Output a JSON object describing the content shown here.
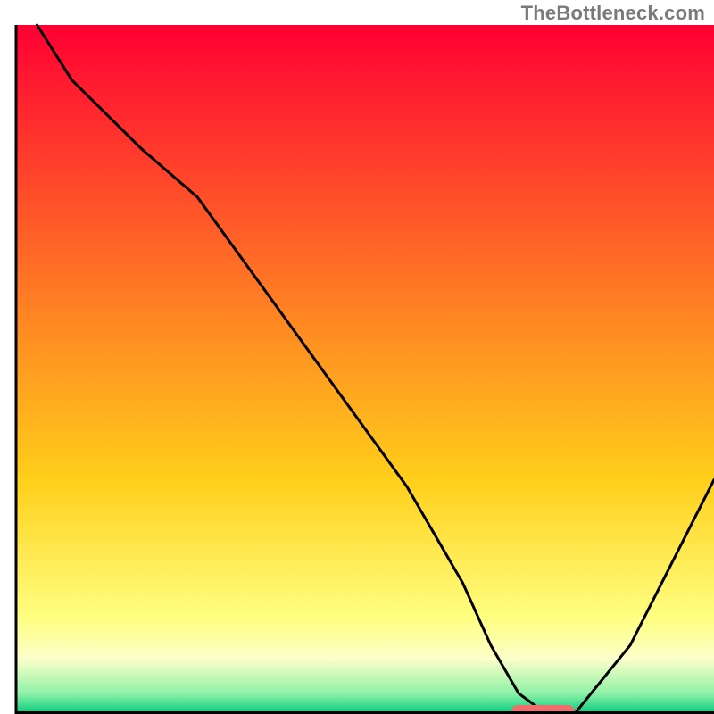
{
  "watermark": "TheBottleneck.com",
  "chart_data": {
    "type": "line",
    "title": "",
    "xlabel": "",
    "ylabel": "",
    "xlim": [
      0,
      100
    ],
    "ylim": [
      0,
      100
    ],
    "gradient_bands": [
      {
        "y0": 0,
        "y1": 66,
        "c0": "#ff0033",
        "c1": "#ffcf1a"
      },
      {
        "y0": 66,
        "y1": 86,
        "c0": "#ffcf1a",
        "c1": "#ffff80"
      },
      {
        "y0": 86,
        "y1": 92,
        "c0": "#ffff80",
        "c1": "#fcffc9"
      },
      {
        "y0": 92,
        "y1": 97,
        "c0": "#fcffc9",
        "c1": "#8ff2a8"
      },
      {
        "y0": 97,
        "y1": 100,
        "c0": "#8ff2a8",
        "c1": "#00c97a"
      }
    ],
    "series": [
      {
        "name": "bottleneck-curve",
        "x": [
          3,
          8,
          18,
          26,
          36,
          46,
          56,
          64,
          68,
          72,
          76,
          80,
          88,
          96,
          100
        ],
        "y": [
          100,
          92,
          82,
          75,
          61,
          47,
          33,
          19,
          10,
          3,
          0,
          0,
          10,
          26,
          34
        ]
      }
    ],
    "marker": {
      "x0": 71,
      "x1": 80,
      "y": 0,
      "color": "#f26d6d"
    },
    "frame": {
      "color": "#000000",
      "width": 3
    }
  }
}
